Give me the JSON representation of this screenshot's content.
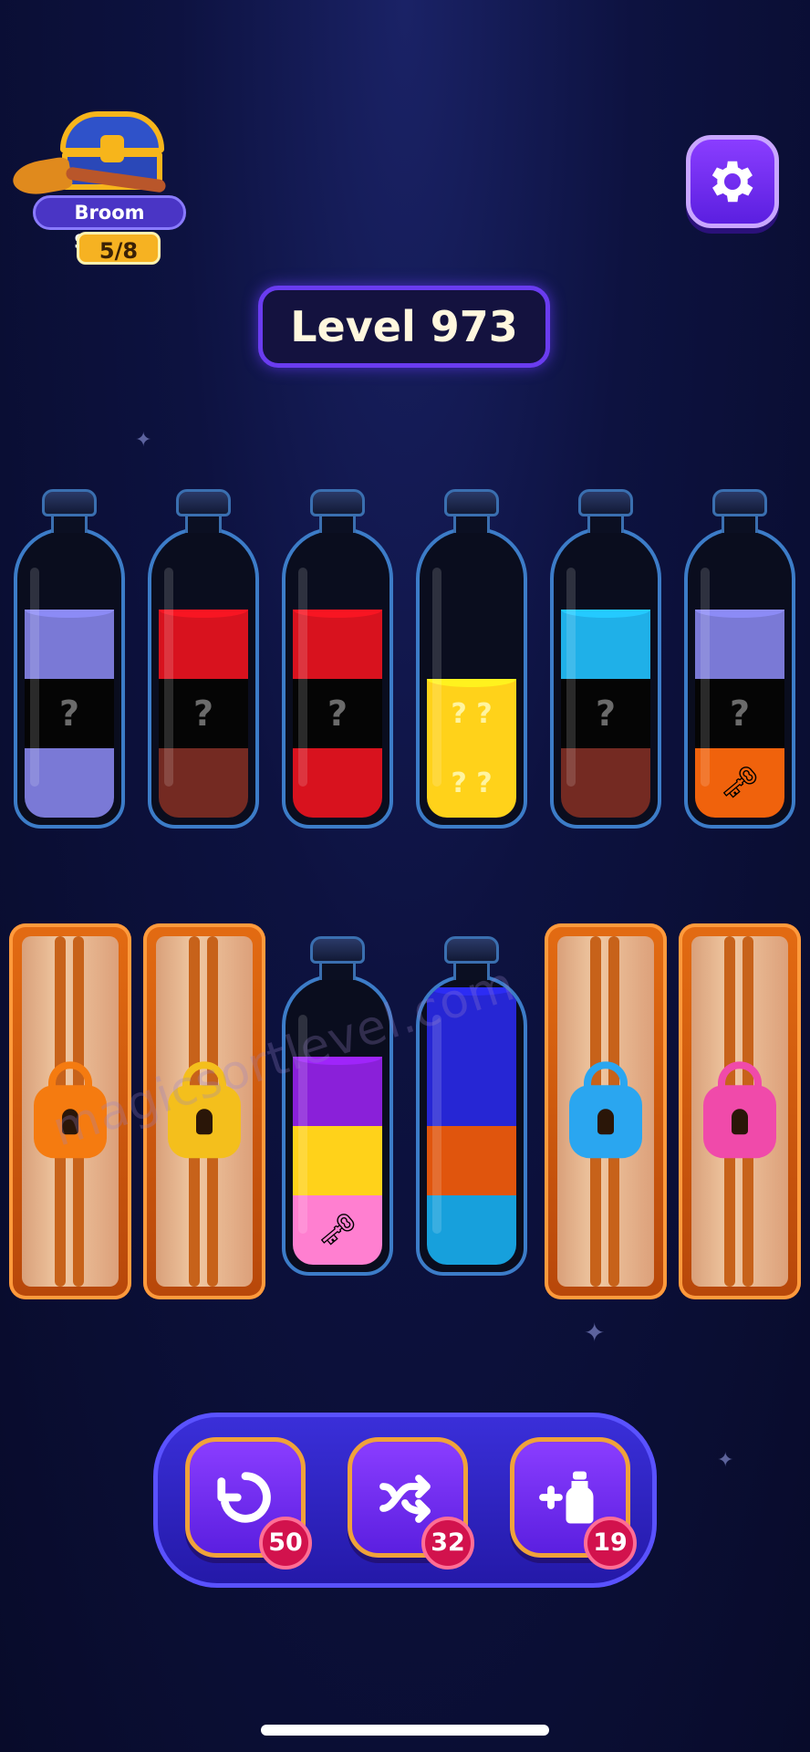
{
  "streak": {
    "label": "Broom Streak",
    "count": "5/8"
  },
  "level": {
    "label": "Level 973"
  },
  "colors": {
    "lavender": "#7a79d6",
    "red": "#d8121e",
    "darkred": "#742a22",
    "black": "#050505",
    "yellow": "#ffd21a",
    "cyan": "#1fb0e8",
    "orange": "#f0620c",
    "purple": "#8a20d9",
    "pink": "#ff7fd0",
    "blue": "#2626d4",
    "darkorange": "#e0550d",
    "lightblue": "#17a0dc"
  },
  "bottles_top": [
    {
      "layers": [
        "lavender",
        "hidden",
        "lavender"
      ]
    },
    {
      "layers": [
        "red",
        "hidden",
        "darkred"
      ]
    },
    {
      "layers": [
        "red",
        "hidden",
        "red"
      ]
    },
    {
      "layers": [
        "yellow-mystery",
        "yellow-mystery"
      ]
    },
    {
      "layers": [
        "cyan",
        "hidden",
        "darkred"
      ]
    },
    {
      "layers": [
        "lavender",
        "hidden",
        "orange-key"
      ]
    }
  ],
  "bottles_bottom": [
    {
      "layers": [
        "purple",
        "yellow",
        "pink-key"
      ]
    },
    {
      "layers": [
        "blue",
        "blue",
        "darkorange",
        "lightblue"
      ]
    }
  ],
  "locked_crates": [
    {
      "lock_color": "orange"
    },
    {
      "lock_color": "yellow"
    },
    {
      "lock_color": "blue"
    },
    {
      "lock_color": "pink"
    }
  ],
  "actions": [
    {
      "name": "undo",
      "count": "50"
    },
    {
      "name": "shuffle",
      "count": "32"
    },
    {
      "name": "add-bottle",
      "count": "19"
    }
  ],
  "watermark": "magicsortlevel.com"
}
